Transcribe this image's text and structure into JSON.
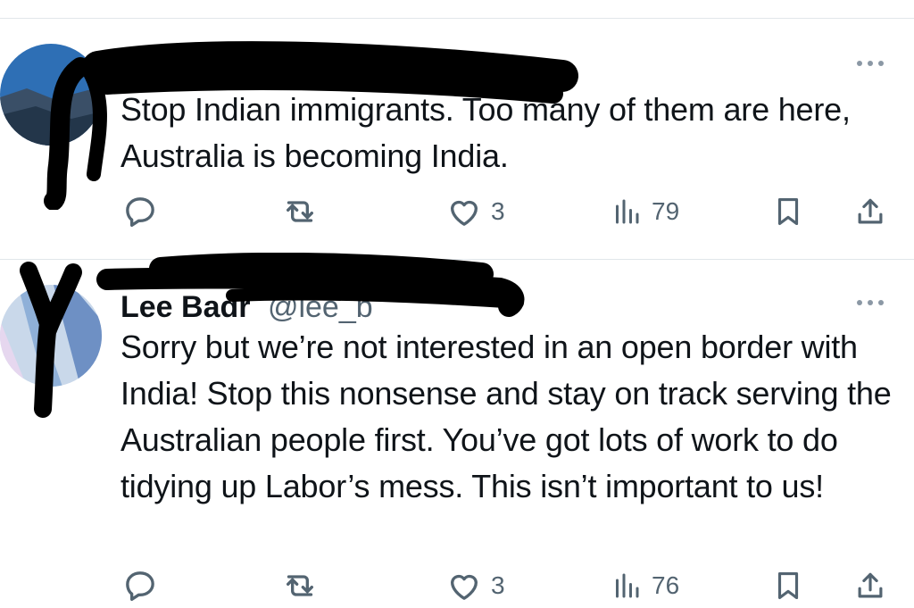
{
  "posts": [
    {
      "author": "",
      "handle": "",
      "time": "",
      "text": "Stop Indian immigrants. Too many of them are here, Australia is becoming India.",
      "actions": {
        "reply": "",
        "repost": "",
        "like": "3",
        "views": "79"
      }
    },
    {
      "author": "Lee Badr",
      "handle": "@lee_b",
      "time": "",
      "text": "Sorry but we’re not interested in an open border with India! Stop this nonsense and stay on track serving the Australian people first. You’ve got lots of work to do tidying up Labor’s mess. This isn’t important to us!",
      "actions": {
        "reply": "",
        "repost": "",
        "like": "3",
        "views": "76"
      }
    }
  ],
  "icons": {
    "reply": "reply-icon",
    "repost": "repost-icon",
    "like": "heart-icon",
    "views": "views-icon",
    "bookmark": "bookmark-icon",
    "share": "share-icon",
    "more": "more-icon"
  },
  "colors": {
    "text": "#0f1419",
    "muted": "#536471",
    "divider": "#e1e6ea"
  }
}
